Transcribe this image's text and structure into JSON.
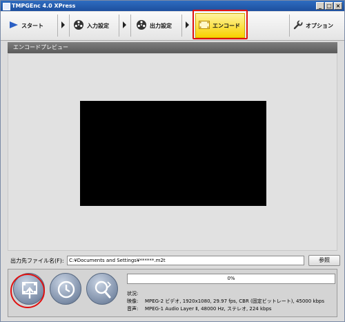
{
  "window": {
    "title": "TMPGEnc 4.0 XPress",
    "controls": [
      "_",
      "□",
      "×"
    ]
  },
  "toolbar": {
    "start_label": "スタート",
    "input_label": "入力設定",
    "output_label": "出力設定",
    "encode_label": "エンコード",
    "options_label": "オプション",
    "highlight_color": "#e01010",
    "encode_color": "#f8d200"
  },
  "panel": {
    "header": "エンコードプレビュー"
  },
  "output": {
    "label": "出力先ファイル名(F):",
    "path": "C:¥Documents and Settings¥******.m2t",
    "browse_label": "参照"
  },
  "encode": {
    "progress_text": "0%",
    "progress_fraction": 0,
    "status_heading": "状況:",
    "video_label": "映像:",
    "video_value": "MPEG-2 ビデオ, 1920x1080, 29.97 fps, CBR (固定ビットレート), 45000 kbps",
    "audio_label": "音声:",
    "audio_value": "MPEG-1 Audio Layer Ⅱ, 48000 Hz, ステレオ, 224 kbps"
  },
  "icons": {
    "encode_start": "film-upload-icon",
    "batch": "clock-icon",
    "preview": "magnifier-icon"
  }
}
